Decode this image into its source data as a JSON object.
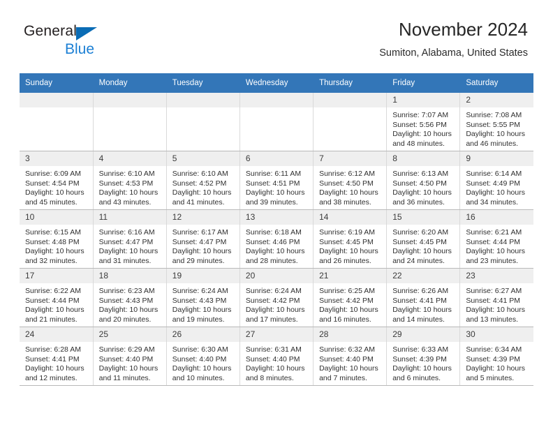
{
  "brand": {
    "line1": "General",
    "line2": "Blue",
    "triangle_color": "#0a6cb5",
    "blue_text_color": "#1b7fd4"
  },
  "header": {
    "title": "November 2024",
    "subtitle": "Sumiton, Alabama, United States"
  },
  "theme": {
    "header_row_bg": "#3376b8",
    "header_row_text": "#ffffff",
    "daynum_bg": "#efefef",
    "cell_bg": "#ffffff",
    "grid_line": "#b9b9b9"
  },
  "weekday_headers": [
    "Sunday",
    "Monday",
    "Tuesday",
    "Wednesday",
    "Thursday",
    "Friday",
    "Saturday"
  ],
  "labels": {
    "sunrise_prefix": "Sunrise:",
    "sunset_prefix": "Sunset:",
    "daylight_prefix": "Daylight:"
  },
  "weeks": [
    [
      {
        "day": "",
        "blank": true
      },
      {
        "day": "",
        "blank": true
      },
      {
        "day": "",
        "blank": true
      },
      {
        "day": "",
        "blank": true
      },
      {
        "day": "",
        "blank": true
      },
      {
        "day": "1",
        "sunrise": "Sunrise: 7:07 AM",
        "sunset": "Sunset: 5:56 PM",
        "daylight1": "Daylight: 10 hours",
        "daylight2": "and 48 minutes."
      },
      {
        "day": "2",
        "sunrise": "Sunrise: 7:08 AM",
        "sunset": "Sunset: 5:55 PM",
        "daylight1": "Daylight: 10 hours",
        "daylight2": "and 46 minutes."
      }
    ],
    [
      {
        "day": "3",
        "sunrise": "Sunrise: 6:09 AM",
        "sunset": "Sunset: 4:54 PM",
        "daylight1": "Daylight: 10 hours",
        "daylight2": "and 45 minutes."
      },
      {
        "day": "4",
        "sunrise": "Sunrise: 6:10 AM",
        "sunset": "Sunset: 4:53 PM",
        "daylight1": "Daylight: 10 hours",
        "daylight2": "and 43 minutes."
      },
      {
        "day": "5",
        "sunrise": "Sunrise: 6:10 AM",
        "sunset": "Sunset: 4:52 PM",
        "daylight1": "Daylight: 10 hours",
        "daylight2": "and 41 minutes."
      },
      {
        "day": "6",
        "sunrise": "Sunrise: 6:11 AM",
        "sunset": "Sunset: 4:51 PM",
        "daylight1": "Daylight: 10 hours",
        "daylight2": "and 39 minutes."
      },
      {
        "day": "7",
        "sunrise": "Sunrise: 6:12 AM",
        "sunset": "Sunset: 4:50 PM",
        "daylight1": "Daylight: 10 hours",
        "daylight2": "and 38 minutes."
      },
      {
        "day": "8",
        "sunrise": "Sunrise: 6:13 AM",
        "sunset": "Sunset: 4:50 PM",
        "daylight1": "Daylight: 10 hours",
        "daylight2": "and 36 minutes."
      },
      {
        "day": "9",
        "sunrise": "Sunrise: 6:14 AM",
        "sunset": "Sunset: 4:49 PM",
        "daylight1": "Daylight: 10 hours",
        "daylight2": "and 34 minutes."
      }
    ],
    [
      {
        "day": "10",
        "sunrise": "Sunrise: 6:15 AM",
        "sunset": "Sunset: 4:48 PM",
        "daylight1": "Daylight: 10 hours",
        "daylight2": "and 32 minutes."
      },
      {
        "day": "11",
        "sunrise": "Sunrise: 6:16 AM",
        "sunset": "Sunset: 4:47 PM",
        "daylight1": "Daylight: 10 hours",
        "daylight2": "and 31 minutes."
      },
      {
        "day": "12",
        "sunrise": "Sunrise: 6:17 AM",
        "sunset": "Sunset: 4:47 PM",
        "daylight1": "Daylight: 10 hours",
        "daylight2": "and 29 minutes."
      },
      {
        "day": "13",
        "sunrise": "Sunrise: 6:18 AM",
        "sunset": "Sunset: 4:46 PM",
        "daylight1": "Daylight: 10 hours",
        "daylight2": "and 28 minutes."
      },
      {
        "day": "14",
        "sunrise": "Sunrise: 6:19 AM",
        "sunset": "Sunset: 4:45 PM",
        "daylight1": "Daylight: 10 hours",
        "daylight2": "and 26 minutes."
      },
      {
        "day": "15",
        "sunrise": "Sunrise: 6:20 AM",
        "sunset": "Sunset: 4:45 PM",
        "daylight1": "Daylight: 10 hours",
        "daylight2": "and 24 minutes."
      },
      {
        "day": "16",
        "sunrise": "Sunrise: 6:21 AM",
        "sunset": "Sunset: 4:44 PM",
        "daylight1": "Daylight: 10 hours",
        "daylight2": "and 23 minutes."
      }
    ],
    [
      {
        "day": "17",
        "sunrise": "Sunrise: 6:22 AM",
        "sunset": "Sunset: 4:44 PM",
        "daylight1": "Daylight: 10 hours",
        "daylight2": "and 21 minutes."
      },
      {
        "day": "18",
        "sunrise": "Sunrise: 6:23 AM",
        "sunset": "Sunset: 4:43 PM",
        "daylight1": "Daylight: 10 hours",
        "daylight2": "and 20 minutes."
      },
      {
        "day": "19",
        "sunrise": "Sunrise: 6:24 AM",
        "sunset": "Sunset: 4:43 PM",
        "daylight1": "Daylight: 10 hours",
        "daylight2": "and 19 minutes."
      },
      {
        "day": "20",
        "sunrise": "Sunrise: 6:24 AM",
        "sunset": "Sunset: 4:42 PM",
        "daylight1": "Daylight: 10 hours",
        "daylight2": "and 17 minutes."
      },
      {
        "day": "21",
        "sunrise": "Sunrise: 6:25 AM",
        "sunset": "Sunset: 4:42 PM",
        "daylight1": "Daylight: 10 hours",
        "daylight2": "and 16 minutes."
      },
      {
        "day": "22",
        "sunrise": "Sunrise: 6:26 AM",
        "sunset": "Sunset: 4:41 PM",
        "daylight1": "Daylight: 10 hours",
        "daylight2": "and 14 minutes."
      },
      {
        "day": "23",
        "sunrise": "Sunrise: 6:27 AM",
        "sunset": "Sunset: 4:41 PM",
        "daylight1": "Daylight: 10 hours",
        "daylight2": "and 13 minutes."
      }
    ],
    [
      {
        "day": "24",
        "sunrise": "Sunrise: 6:28 AM",
        "sunset": "Sunset: 4:41 PM",
        "daylight1": "Daylight: 10 hours",
        "daylight2": "and 12 minutes."
      },
      {
        "day": "25",
        "sunrise": "Sunrise: 6:29 AM",
        "sunset": "Sunset: 4:40 PM",
        "daylight1": "Daylight: 10 hours",
        "daylight2": "and 11 minutes."
      },
      {
        "day": "26",
        "sunrise": "Sunrise: 6:30 AM",
        "sunset": "Sunset: 4:40 PM",
        "daylight1": "Daylight: 10 hours",
        "daylight2": "and 10 minutes."
      },
      {
        "day": "27",
        "sunrise": "Sunrise: 6:31 AM",
        "sunset": "Sunset: 4:40 PM",
        "daylight1": "Daylight: 10 hours",
        "daylight2": "and 8 minutes."
      },
      {
        "day": "28",
        "sunrise": "Sunrise: 6:32 AM",
        "sunset": "Sunset: 4:40 PM",
        "daylight1": "Daylight: 10 hours",
        "daylight2": "and 7 minutes."
      },
      {
        "day": "29",
        "sunrise": "Sunrise: 6:33 AM",
        "sunset": "Sunset: 4:39 PM",
        "daylight1": "Daylight: 10 hours",
        "daylight2": "and 6 minutes."
      },
      {
        "day": "30",
        "sunrise": "Sunrise: 6:34 AM",
        "sunset": "Sunset: 4:39 PM",
        "daylight1": "Daylight: 10 hours",
        "daylight2": "and 5 minutes."
      }
    ]
  ]
}
